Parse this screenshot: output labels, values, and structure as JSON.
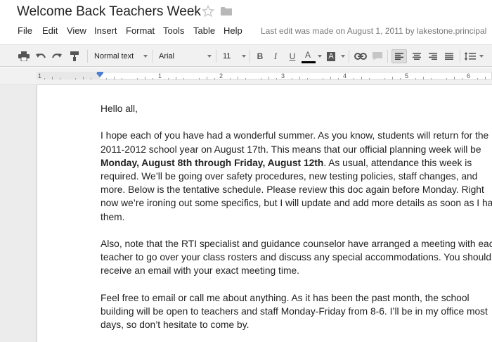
{
  "document": {
    "title": "Welcome Back Teachers Week"
  },
  "menu": {
    "items": [
      "File",
      "Edit",
      "View",
      "Insert",
      "Format",
      "Tools",
      "Table",
      "Help"
    ],
    "last_edit": "Last edit was made on August 1, 2011 by lakestone.principal"
  },
  "toolbar": {
    "style": "Normal text",
    "font": "Arial",
    "size": "11",
    "bold_label": "B",
    "italic_label": "I",
    "underline_label": "U",
    "text_color_label": "A",
    "highlight_label": "A"
  },
  "ruler": {
    "numbers": [
      "1",
      "1",
      "2",
      "3",
      "4",
      "5",
      "6"
    ]
  },
  "body": {
    "greeting": "Hello all,",
    "p1": {
      "l1": "I hope each of you have had a wonderful summer. As you know, students will return for the",
      "l2": "2011-2012 school year on August 17th. This means that our official planning week will be",
      "l3_bold": "Monday, August 8th through Friday, August 12th",
      "l3_rest": ". As usual, attendance this week is",
      "l4": "required. We’ll be going over safety procedures, new testing policies, staff changes, and",
      "l5": "more. Below is the tentative schedule. Please review this doc again before Monday. Right",
      "l6": "now we’re ironing out some specifics, but I will update and add more details as soon as I ha",
      "l7": "them."
    },
    "p2": {
      "l1": "Also, note that the RTI specialist and guidance counselor have arranged a meeting with eac",
      "l2": "teacher to go over your class rosters and discuss any special accommodations. You should",
      "l3": "receive an email with your exact meeting time."
    },
    "p3": {
      "l1": "Feel free to email or call me about anything. As it has been the past month, the school",
      "l2": "building will be open to teachers and staff  Monday-Friday from 8-6. I’ll be in my office most",
      "l3": "days, so don’t hesitate to come by."
    }
  },
  "colors": {
    "text_color_underline": "#000000",
    "ruler_marker": "#4a7fd4"
  }
}
